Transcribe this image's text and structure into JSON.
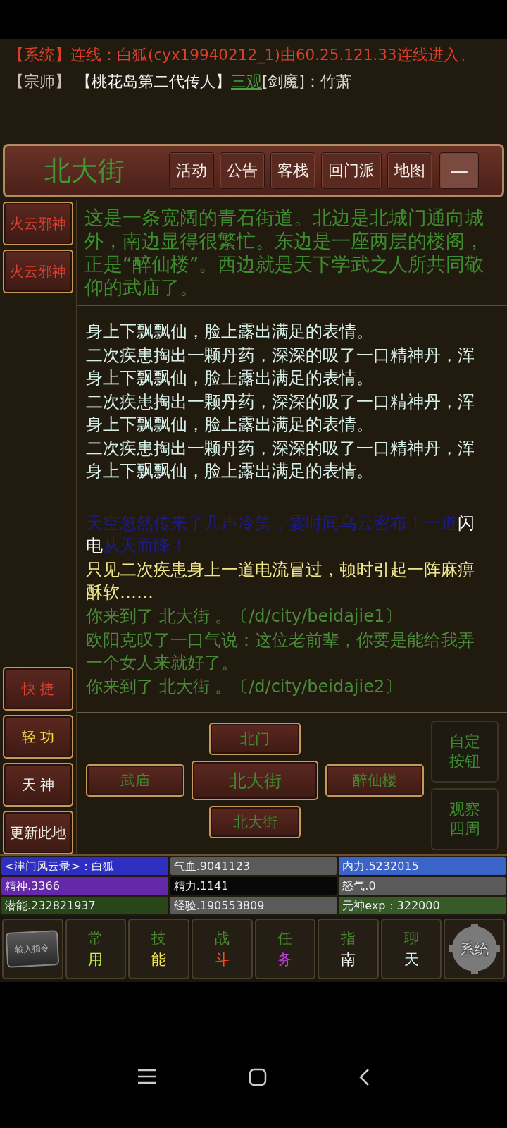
{
  "system_messages": [
    {
      "parts": [
        {
          "text": "【系统】连线：白狐(cyx19940212_1)由60.25.121.33连线进入。",
          "kind": "system"
        }
      ]
    },
    {
      "parts": [
        {
          "text": "【宗师】",
          "kind": "rank"
        },
        {
          "text": "【桃花岛第二代传人】",
          "kind": "title"
        },
        {
          "text": "三观",
          "kind": "link"
        },
        {
          "text": "[剑魔]：竹萧",
          "kind": "name"
        }
      ]
    }
  ],
  "room": {
    "title": "北大街",
    "actions": [
      "活动",
      "公告",
      "客栈",
      "回门派",
      "地图"
    ],
    "collapse": "—"
  },
  "side_buttons": [
    {
      "label": "火云邪神"
    },
    {
      "label": "火云邪神"
    }
  ],
  "description": "这是一条宽阔的青石街道。北边是北城门通向城外，南边显得很繁忙。东边是一座两层的楼阁，正是“醉仙楼”。西边就是天下学武之人所共同敬仰的武庙了。",
  "log": [
    {
      "kind": "status",
      "parts": [
        {
          "text": "身上下飘飘仙，脸上露出满足的表情。",
          "kind": "plain"
        }
      ]
    },
    {
      "kind": "status",
      "parts": [
        {
          "text": "二次疾患掏出一颗丹药，深深的吸了一口精神丹，浑身上下飘飘仙，脸上露出满足的表情。",
          "kind": "plain"
        }
      ]
    },
    {
      "kind": "status",
      "parts": [
        {
          "text": "二次疾患掏出一颗丹药，深深的吸了一口精神丹，浑身上下飘飘仙，脸上露出满足的表情。",
          "kind": "plain"
        }
      ]
    },
    {
      "kind": "status",
      "parts": [
        {
          "text": "二次疾患掏出一颗丹药，深深的吸了一口精神丹，浑身上下飘飘仙，脸上露出满足的表情。",
          "kind": "plain"
        }
      ]
    },
    {
      "kind": "weather",
      "parts": [
        {
          "text": "天空忽然传来了几声冷笑，霎时间乌云密布！一道",
          "kind": "plain"
        },
        {
          "text": "闪电",
          "kind": "highlight"
        },
        {
          "text": "从天而降！",
          "kind": "plain"
        }
      ]
    },
    {
      "kind": "effect",
      "parts": [
        {
          "text": "只见二次疾患身上一道电流冒过，顿时引起一阵麻痹酥软……",
          "kind": "plain"
        }
      ]
    },
    {
      "kind": "move",
      "parts": [
        {
          "text": "你来到了 北大街 。〔/d/city/beidajie1〕",
          "kind": "plain"
        }
      ]
    },
    {
      "kind": "move",
      "parts": [
        {
          "text": "欧阳克叹了一口气说：这位老前辈，你要是能给我弄一个女人来就好了。",
          "kind": "plain"
        }
      ]
    },
    {
      "kind": "move",
      "parts": [
        {
          "text": "你来到了 北大街 。〔/d/city/beidajie2〕",
          "kind": "plain"
        }
      ]
    }
  ],
  "quick_buttons": [
    {
      "label": "快 捷",
      "color": "#e04030"
    },
    {
      "label": "轻 功",
      "color": "#f0e040"
    },
    {
      "label": "天 神",
      "color": "#e8f4f4"
    },
    {
      "label": "更新此地",
      "color": "#f0ece0"
    }
  ],
  "exits": [
    {
      "label": "北门",
      "kind": "north"
    },
    {
      "label": "武庙",
      "kind": "west"
    },
    {
      "label": "北大街",
      "kind": "center"
    },
    {
      "label": "醉仙楼",
      "kind": "east"
    },
    {
      "label": "北大街",
      "kind": "south"
    }
  ],
  "map_tools": [
    {
      "label": "自定按钮"
    },
    {
      "label": "观察四周"
    }
  ],
  "stats": [
    {
      "text": "<津门风云录>：白狐",
      "color": "#2e2ec0"
    },
    {
      "text": "气血.9041123",
      "color": "#5a5a5a"
    },
    {
      "text": "内力.5232015",
      "color": "#3a64c8"
    },
    {
      "text": "精神.3366",
      "color": "#6428a8"
    },
    {
      "text": "精力.1141",
      "color": "#080808"
    },
    {
      "text": "怒气.0",
      "color": "#5a5a5a"
    },
    {
      "text": "潜能.232821937",
      "color": "#28461a"
    },
    {
      "text": "经验.190553809",
      "color": "#5a5a5a"
    },
    {
      "text": "元神exp：322000",
      "color": "#365a28"
    }
  ],
  "nav": [
    {
      "kind": "command",
      "label": "输入指令"
    },
    {
      "kind": "tab",
      "top": "常",
      "bottom": "用",
      "color": "#c8f050"
    },
    {
      "kind": "tab",
      "top": "技",
      "bottom": "能",
      "color": "#f0e850"
    },
    {
      "kind": "tab",
      "top": "战",
      "bottom": "斗",
      "color": "#f05020"
    },
    {
      "kind": "tab",
      "top": "任",
      "bottom": "务",
      "color": "#c040e0"
    },
    {
      "kind": "tab",
      "top": "指",
      "bottom": "南",
      "color": "#ffffff"
    },
    {
      "kind": "tab",
      "top": "聊",
      "bottom": "天",
      "color": "#d0f8f8"
    },
    {
      "kind": "system",
      "label": "系统"
    }
  ]
}
